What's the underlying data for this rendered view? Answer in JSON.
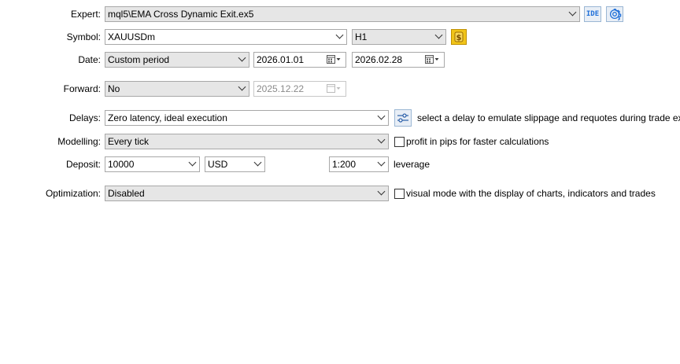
{
  "expert": {
    "label": "Expert:",
    "value": "mql5\\EMA Cross Dynamic Exit.ex5",
    "ide_label": "IDE"
  },
  "symbol": {
    "label": "Symbol:",
    "value": "XAUUSDm",
    "timeframe": "H1"
  },
  "date": {
    "label": "Date:",
    "mode": "Custom period",
    "from": "2026.01.01",
    "to": "2026.02.28"
  },
  "forward": {
    "label": "Forward:",
    "mode": "No",
    "date": "2025.12.22"
  },
  "delays": {
    "label": "Delays:",
    "value": "Zero latency, ideal execution",
    "hint": "select a delay to emulate slippage and requotes during trade execution"
  },
  "modelling": {
    "label": "Modelling:",
    "value": "Every tick",
    "checkbox_label": "profit in pips for faster calculations"
  },
  "deposit": {
    "label": "Deposit:",
    "amount": "10000",
    "currency": "USD",
    "leverage": "1:200",
    "leverage_label": "leverage"
  },
  "optimization": {
    "label": "Optimization:",
    "value": "Disabled",
    "checkbox_label": "visual mode with the display of charts, indicators and trades"
  },
  "colors": {
    "accent": "#1e6fd9",
    "symbol_button": "#f0c419",
    "field_grey": "#e6e6e6",
    "border": "#a8a8a8"
  }
}
